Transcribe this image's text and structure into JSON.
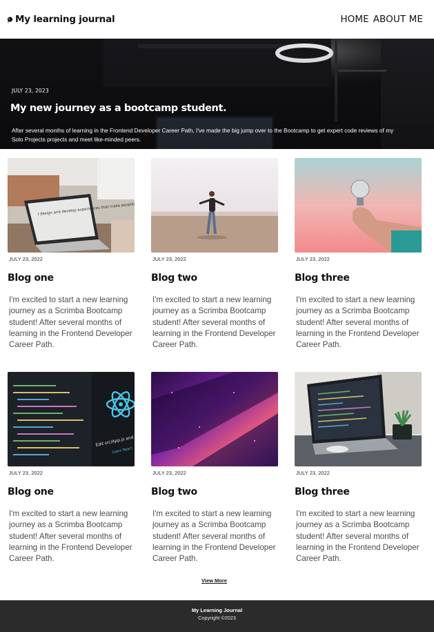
{
  "header": {
    "brand_title": "My learning journal",
    "brand_icon": "bubble-icon",
    "nav": [
      {
        "label": "HOME"
      },
      {
        "label": "ABOUT ME"
      }
    ]
  },
  "hero": {
    "date": "JULY 23, 2023",
    "title": "My new journey as a bootcamp student.",
    "text": "After several months of learning in the Frontend Developer Career Path, I've made the big jump over to the Bootcamp to get expert code reviews of my Solo Projects projects and meet like-minded peers."
  },
  "posts": [
    {
      "date": "JULY 23, 2022",
      "title": "Blog one",
      "text": "I'm excited to start a new learning journey as a Scrimba Bootcamp student! After several months of learning in the Frontend Developer Career Path.",
      "image": "laptop-design-photo",
      "image_text": "I design and develop experiences that make peoples lives simple."
    },
    {
      "date": "JULY 23, 2022",
      "title": "Blog two",
      "text": "I'm excited to start a new learning journey as a Scrimba Bootcamp student! After several months of learning in the Frontend Developer Career Path.",
      "image": "beach-dancer-photo"
    },
    {
      "date": "JULY 23, 2022",
      "title": "Blog three",
      "text": "I'm excited to start a new learning journey as a Scrimba Bootcamp student! After several months of learning in the Frontend Developer Career Path.",
      "image": "lightbulb-hand-photo"
    },
    {
      "date": "JULY 23, 2022",
      "title": "Blog one",
      "text": "I'm excited to start a new learning journey as a Scrimba Bootcamp student! After several months of learning in the Frontend Developer Career Path.",
      "image": "react-code-photo",
      "image_text": "Edit src/App.js and save",
      "image_link": "Learn React"
    },
    {
      "date": "JULY 23, 2022",
      "title": "Blog two",
      "text": "I'm excited to start a new learning journey as a Scrimba Bootcamp student! After several months of learning in the Frontend Developer Career Path.",
      "image": "purple-light-photo"
    },
    {
      "date": "JULY 23, 2022",
      "title": "Blog three",
      "text": "I'm excited to start a new learning journey as a Scrimba Bootcamp student! After several months of learning in the Frontend Developer Career Path.",
      "image": "laptop-plant-photo"
    }
  ],
  "view_more": "View More",
  "footer": {
    "title": "My Learning Journal",
    "copyright": "Copyright ©2023"
  },
  "colors": {
    "footer_bg": "#2b2b2b",
    "text_dark": "#111111",
    "text_muted": "#4a4a4a"
  }
}
